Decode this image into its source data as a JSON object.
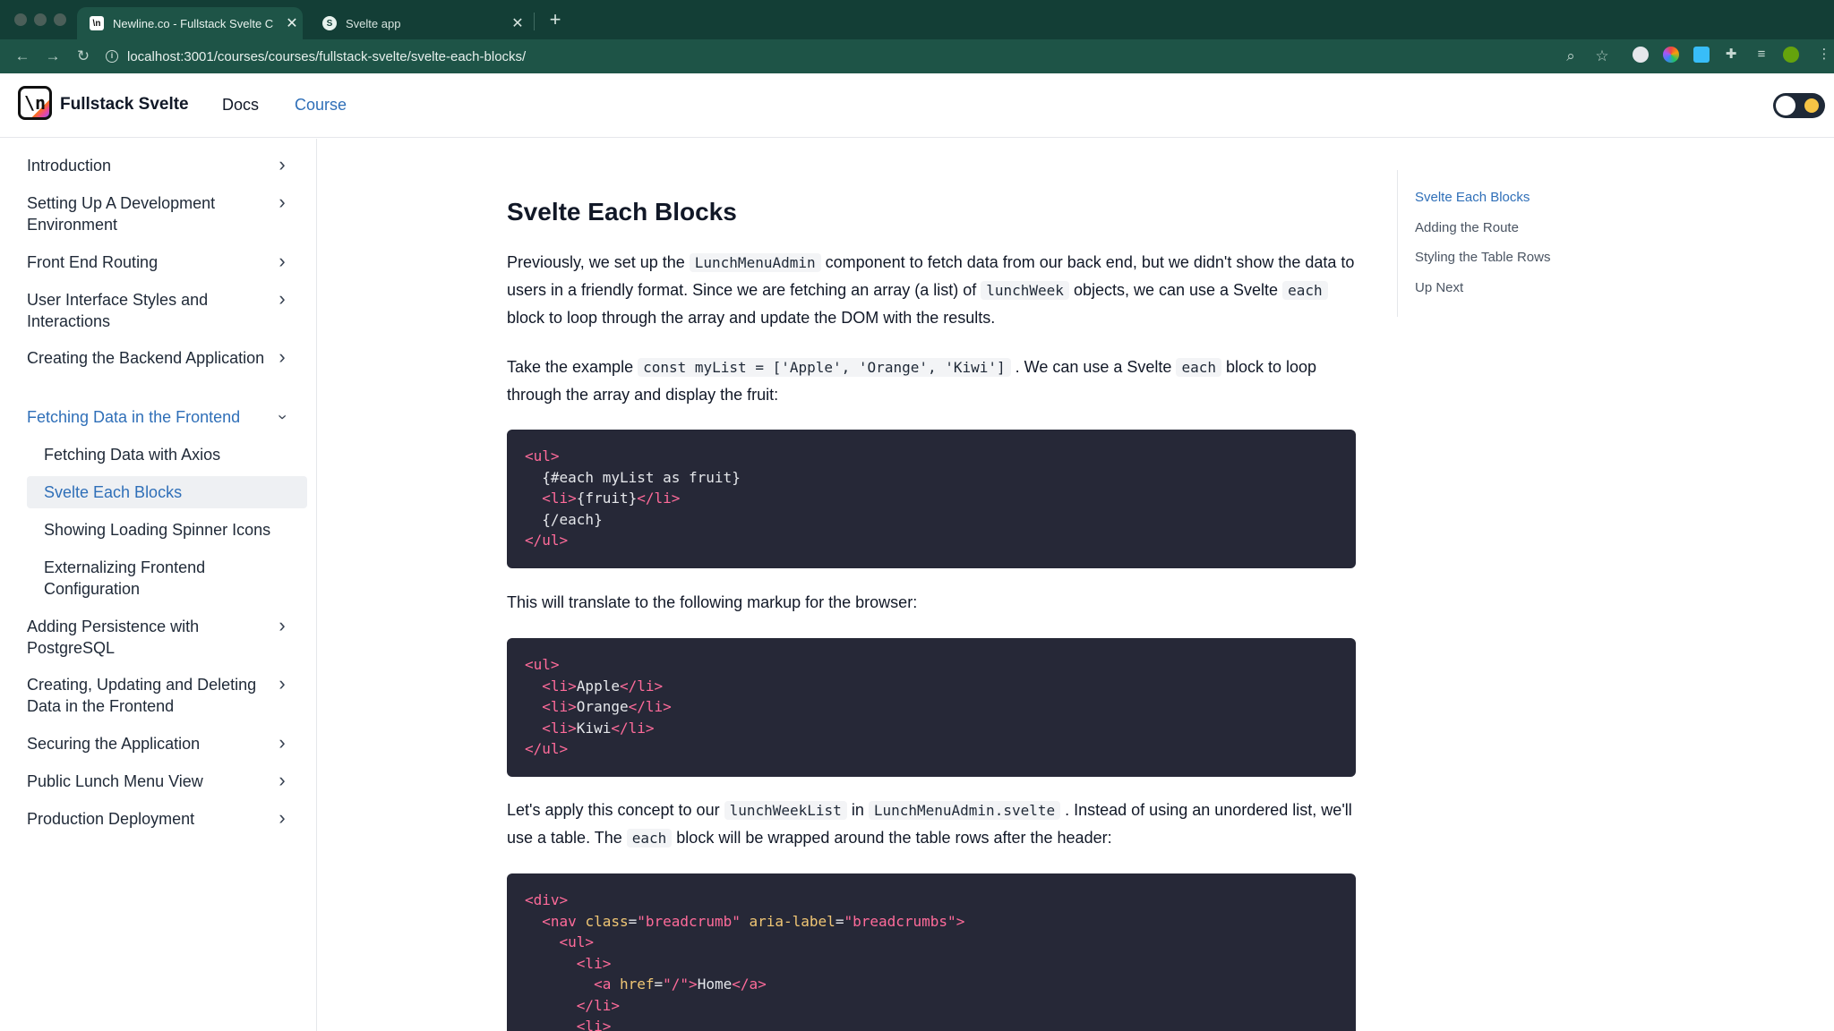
{
  "browser": {
    "tabs": [
      {
        "title": "Newline.co - Fullstack Svelte C",
        "active": true
      },
      {
        "title": "Svelte app",
        "active": false
      }
    ],
    "url": "localhost:3001/courses/courses/fullstack-svelte/svelte-each-blocks/"
  },
  "header": {
    "brand": "Fullstack Svelte",
    "logo_text": "\\n",
    "nav": [
      "Docs",
      "Course"
    ]
  },
  "sidebar": {
    "items": [
      {
        "label": "Introduction"
      },
      {
        "label": "Setting Up A Development Environment"
      },
      {
        "label": "Front End Routing"
      },
      {
        "label": "User Interface Styles and Interactions"
      },
      {
        "label": "Creating the Backend Application"
      },
      {
        "label": "Fetching Data in the Frontend",
        "expanded": true,
        "children": [
          {
            "label": "Fetching Data with Axios"
          },
          {
            "label": "Svelte Each Blocks",
            "active": true
          },
          {
            "label": "Showing Loading Spinner Icons"
          },
          {
            "label": "Externalizing Frontend Configuration"
          }
        ]
      },
      {
        "label": "Adding Persistence with PostgreSQL"
      },
      {
        "label": "Creating, Updating and Deleting Data in the Frontend"
      },
      {
        "label": "Securing the Application"
      },
      {
        "label": "Public Lunch Menu View"
      },
      {
        "label": "Production Deployment"
      }
    ]
  },
  "article": {
    "title": "Svelte Each Blocks",
    "p1": {
      "a": "Previously, we set up the ",
      "code1": "LunchMenuAdmin",
      "b": " component to fetch data from our back end, but we didn't show the data to users in a friendly format. Since we are fetching an array (a list) of ",
      "code2": "lunchWeek",
      "c": " objects, we can use a Svelte ",
      "code3": "each",
      "d": " block to loop through the array and update the DOM with the results."
    },
    "p2": {
      "a": "Take the example ",
      "code1": "const myList = ['Apple', 'Orange', 'Kiwi']",
      "b": " . We can use a Svelte ",
      "code2": "each",
      "c": " block to loop through the array and display the fruit:"
    },
    "code1_lines": [
      "<ul>",
      "  {#each myList as fruit}",
      "  <li>{fruit}</li>",
      "  {/each}",
      "</ul>"
    ],
    "p3": "This will translate to the following markup for the browser:",
    "code2_lines": [
      "<ul>",
      "  <li>Apple</li>",
      "  <li>Orange</li>",
      "  <li>Kiwi</li>",
      "</ul>"
    ],
    "p4": {
      "a": "Let's apply this concept to our ",
      "code1": "lunchWeekList",
      "b": " in ",
      "code2": "LunchMenuAdmin.svelte",
      "c": " . Instead of using an unordered list, we'll use a table. The ",
      "code3": "each",
      "d": " block will be wrapped around the table rows after the header:"
    },
    "code3_lines": [
      "<div>",
      "  <nav class=\"breadcrumb\" aria-label=\"breadcrumbs\">",
      "    <ul>",
      "      <li>",
      "        <a href=\"/\">Home</a>",
      "      </li>",
      "      <li>"
    ]
  },
  "toc": [
    "Svelte Each Blocks",
    "Adding the Route",
    "Styling the Table Rows",
    "Up Next"
  ]
}
